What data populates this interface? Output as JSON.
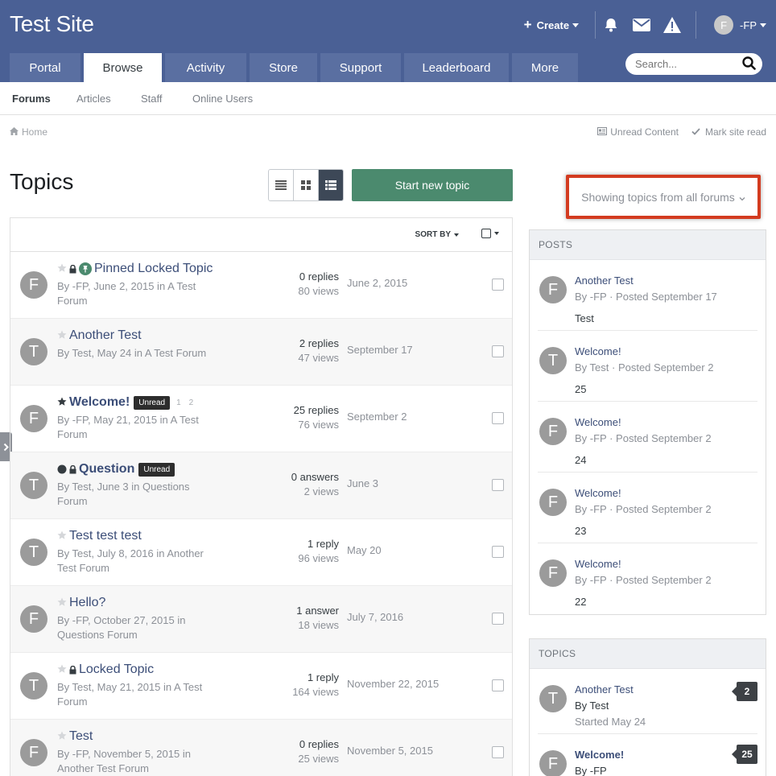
{
  "site_title": "Test Site",
  "user_bar": {
    "create_label": "Create",
    "username": "-FP",
    "avatar_letter": "F"
  },
  "nav": {
    "tabs": [
      {
        "label": "Portal"
      },
      {
        "label": "Browse"
      },
      {
        "label": "Activity"
      },
      {
        "label": "Store"
      },
      {
        "label": "Support"
      },
      {
        "label": "Leaderboard"
      },
      {
        "label": "More"
      }
    ],
    "active": "Browse"
  },
  "search": {
    "placeholder": "Search..."
  },
  "subnav": {
    "items": [
      {
        "label": "Forums"
      },
      {
        "label": "Articles"
      },
      {
        "label": "Staff"
      },
      {
        "label": "Online Users"
      }
    ],
    "active": "Forums"
  },
  "breadcrumb": {
    "home": "Home"
  },
  "actions": {
    "unread": "Unread Content",
    "mark_read": "Mark site read"
  },
  "page_title": "Topics",
  "start_topic_label": "Start new topic",
  "sort_label": "SORT BY",
  "filter_label": "Showing topics from all forums",
  "topics": [
    {
      "avatar": "F",
      "title": "Pinned Locked Topic",
      "meta_by": "By -FP, June 2, 2015 in ",
      "meta_forum": "A Test Forum",
      "stat1": "0 replies",
      "stat2": "80 views",
      "date": "June 2, 2015"
    },
    {
      "avatar": "T",
      "title": "Another Test",
      "meta_by": "By Test, May 24 in ",
      "meta_forum": "A Test Forum",
      "stat1": "2 replies",
      "stat2": "47 views",
      "date": "September 17"
    },
    {
      "avatar": "F",
      "title": "Welcome!",
      "badge": "Unread",
      "page1": "1",
      "page2": "2",
      "meta_by": "By -FP, May 21, 2015 in ",
      "meta_forum": "A Test Forum",
      "stat1": "25 replies",
      "stat2": "76 views",
      "date": "September 2"
    },
    {
      "avatar": "T",
      "title": "Question",
      "badge": "Unread",
      "meta_by": "By Test, June 3 in ",
      "meta_forum": "Questions Forum",
      "stat1": "0 answers",
      "stat2": "2 views",
      "date": "June 3"
    },
    {
      "avatar": "T",
      "title": "Test test test",
      "meta_by": "By Test, July 8, 2016 in ",
      "meta_forum": "Another Test Forum",
      "stat1": "1 reply",
      "stat2": "96 views",
      "date": "May 20"
    },
    {
      "avatar": "F",
      "title": "Hello?",
      "meta_by": "By -FP, October 27, 2015 in ",
      "meta_forum": "Questions Forum",
      "stat1": "1 answer",
      "stat2": "18 views",
      "date": "July 7, 2016"
    },
    {
      "avatar": "T",
      "title": "Locked Topic",
      "meta_by": "By Test, May 21, 2015 in ",
      "meta_forum": "A Test Forum",
      "stat1": "1 reply",
      "stat2": "164 views",
      "date": "November 22, 2015"
    },
    {
      "avatar": "F",
      "title": "Test",
      "meta_by": "By -FP, November 5, 2015 in ",
      "meta_forum": "Another Test Forum",
      "stat1": "0 replies",
      "stat2": "25 views",
      "date": "November 5, 2015"
    }
  ],
  "posts_widget": {
    "header": "POSTS",
    "items": [
      {
        "avatar": "F",
        "title": "Another Test",
        "meta": "By -FP · Posted September 17",
        "body": "Test"
      },
      {
        "avatar": "T",
        "title": "Welcome!",
        "meta": "By Test · Posted September 2",
        "body": "25"
      },
      {
        "avatar": "F",
        "title": "Welcome!",
        "meta": "By -FP · Posted September 2",
        "body": "24"
      },
      {
        "avatar": "F",
        "title": "Welcome!",
        "meta": "By -FP · Posted September 2",
        "body": "23"
      },
      {
        "avatar": "F",
        "title": "Welcome!",
        "meta": "By -FP · Posted September 2",
        "body": "22"
      }
    ]
  },
  "topics_widget": {
    "header": "TOPICS",
    "items": [
      {
        "avatar": "T",
        "title": "Another Test",
        "by": "By Test",
        "started": "Started May 24",
        "count": "2"
      },
      {
        "avatar": "F",
        "title": "Welcome!",
        "by": "By -FP",
        "started": "",
        "count": "25"
      }
    ]
  },
  "colors": {
    "header": "#4a6095",
    "tab": "#5a6fa1",
    "start_button": "#4b8a6e",
    "highlight": "#d33b20",
    "link": "#3c4e78"
  }
}
